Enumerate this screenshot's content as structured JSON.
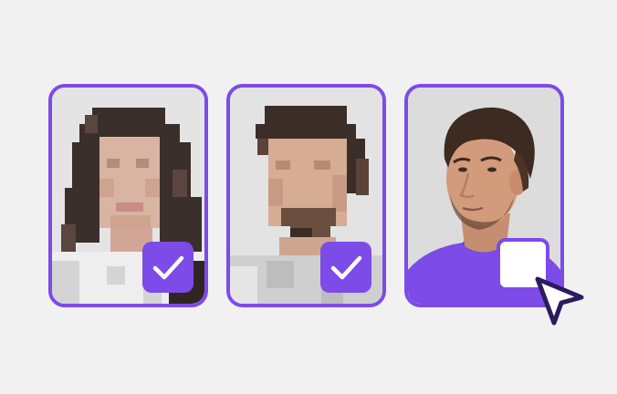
{
  "accent_color": "#7c4be8",
  "background_color": "#f1f1f1",
  "cards": [
    {
      "subject": "woman-photo-pixelated",
      "selected": true,
      "icon": "check-icon"
    },
    {
      "subject": "man-photo-pixelated",
      "selected": true,
      "icon": "check-icon"
    },
    {
      "subject": "man-photo-clear",
      "selected": false,
      "icon": ""
    }
  ],
  "cursor_icon": "mouse-pointer-icon"
}
